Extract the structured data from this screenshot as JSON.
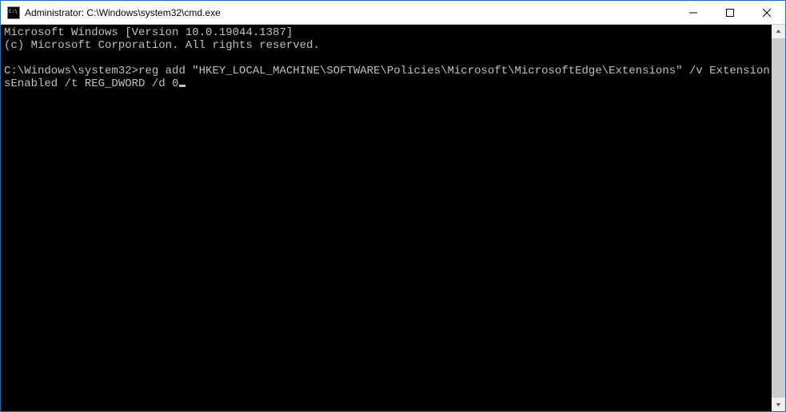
{
  "window": {
    "title": "Administrator: C:\\Windows\\system32\\cmd.exe"
  },
  "terminal": {
    "header_line1": "Microsoft Windows [Version 10.0.19044.1387]",
    "header_line2": "(c) Microsoft Corporation. All rights reserved.",
    "prompt": "C:\\Windows\\system32>",
    "command": "reg add \"HKEY_LOCAL_MACHINE\\SOFTWARE\\Policies\\Microsoft\\MicrosoftEdge\\Extensions\" /v ExtensionsEnabled /t REG_DWORD /d 0"
  }
}
